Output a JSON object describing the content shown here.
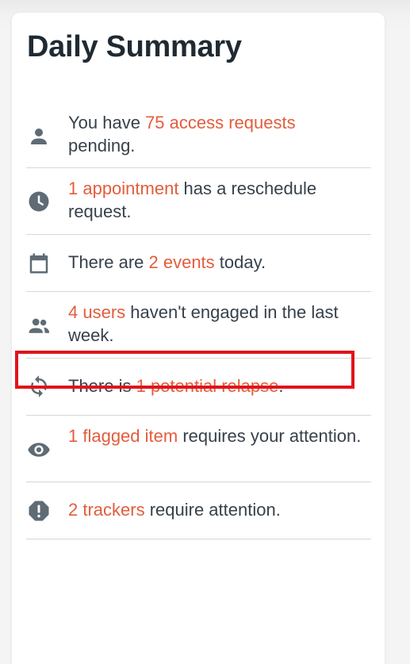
{
  "summary": {
    "title": "Daily Summary",
    "items": [
      {
        "icon": "person-icon",
        "pre": "You have ",
        "link": "75 access requests",
        "post": " pending."
      },
      {
        "icon": "clock-icon",
        "pre": "",
        "link": "1 appointment",
        "post": " has a reschedule request."
      },
      {
        "icon": "calendar-icon",
        "pre": "There are ",
        "link": "2 events",
        "post": " today."
      },
      {
        "icon": "people-icon",
        "pre": "",
        "link": "4 users",
        "post": " haven't engaged in the last week."
      },
      {
        "icon": "sync-icon",
        "pre": "There is ",
        "link": "1 potential relapse",
        "post": "."
      },
      {
        "icon": "eye-icon",
        "pre": "",
        "link": "1 flagged item",
        "post": " requires your attention."
      },
      {
        "icon": "alert-octagon-icon",
        "pre": "",
        "link": "2 trackers",
        "post": " require attention."
      }
    ]
  },
  "colors": {
    "accent": "#e25d3c",
    "text": "#37414a",
    "icon": "#5f6b75",
    "highlight": "#e0141c"
  }
}
